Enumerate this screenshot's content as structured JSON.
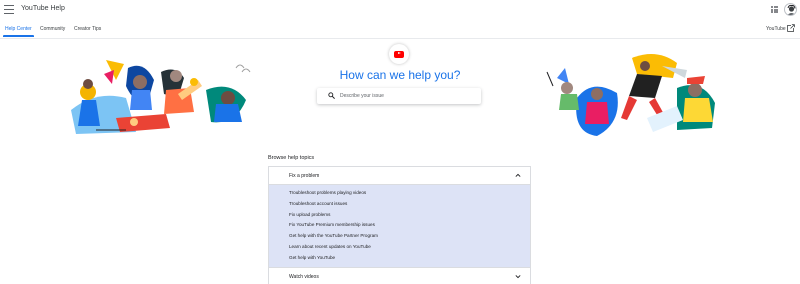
{
  "header": {
    "title": "YouTube Help",
    "menu_icon": "menu-icon",
    "apps_icon": "apps-grid-icon",
    "avatar": "account-avatar"
  },
  "nav": {
    "tabs": [
      {
        "label": "Help Center",
        "active": true
      },
      {
        "label": "Community",
        "active": false
      },
      {
        "label": "Creator Tips",
        "active": false
      }
    ],
    "external_link": "YouTube",
    "external_icon": "open-in-new-icon"
  },
  "hero": {
    "logo_icon": "youtube-logo-icon",
    "title": "How can we help you?",
    "search": {
      "placeholder": "Describe your issue",
      "icon": "search-icon"
    }
  },
  "topics": {
    "heading": "Browse help topics",
    "sections": [
      {
        "label": "Fix a problem",
        "expanded": true,
        "items": [
          "Troubleshoot problems playing videos",
          "Troubleshoot account issues",
          "Fix upload problems",
          "Fix YouTube Premium membership issues",
          "Get help with the YouTube Partner Program",
          "Learn about recent updates on YouTube",
          "Get help with YouTube"
        ]
      },
      {
        "label": "Watch videos",
        "expanded": false,
        "items": []
      }
    ]
  },
  "colors": {
    "accent": "#1a73e8",
    "expanded_bg": "#dde3f6",
    "brand_red": "#ff0000"
  }
}
